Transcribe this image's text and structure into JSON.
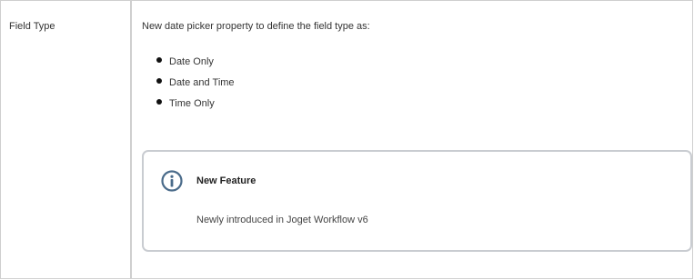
{
  "row": {
    "label": "Field Type",
    "intro": "New date picker property to define the field type as:",
    "options": [
      "Date Only",
      "Date and Time",
      "Time Only"
    ]
  },
  "info_panel": {
    "icon": "info-icon",
    "title": "New Feature",
    "body": "Newly introduced in Joget Workflow v6",
    "colors": {
      "border": "#c9ccd1",
      "icon": "#4a6b8a"
    }
  }
}
